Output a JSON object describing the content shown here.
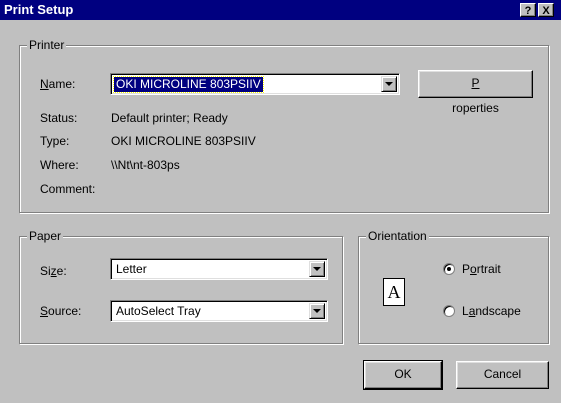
{
  "window": {
    "title": "Print Setup",
    "help_button": "?",
    "close_button": "X"
  },
  "printer": {
    "group_label": "Printer",
    "name_label": "Name:",
    "name_value": "OKI MICROLINE 803PSIIV",
    "properties_label": "Properties",
    "status_label": "Status:",
    "status_value": "Default printer; Ready",
    "type_label": "Type:",
    "type_value": "OKI MICROLINE 803PSIIV",
    "where_label": "Where:",
    "where_value": "\\\\Nt\\nt-803ps",
    "comment_label": "Comment:",
    "comment_value": ""
  },
  "paper": {
    "group_label": "Paper",
    "size_label": "Size:",
    "size_value": "Letter",
    "source_label": "Source:",
    "source_value": "AutoSelect Tray"
  },
  "orientation": {
    "group_label": "Orientation",
    "icon_letter": "A",
    "portrait_label": "Portrait",
    "landscape_label": "Landscape",
    "selected": "portrait"
  },
  "buttons": {
    "ok_label": "OK",
    "cancel_label": "Cancel"
  },
  "colors": {
    "titlebar": "#000080",
    "dialog_face": "#c0c0c0",
    "selection": "#000080"
  }
}
